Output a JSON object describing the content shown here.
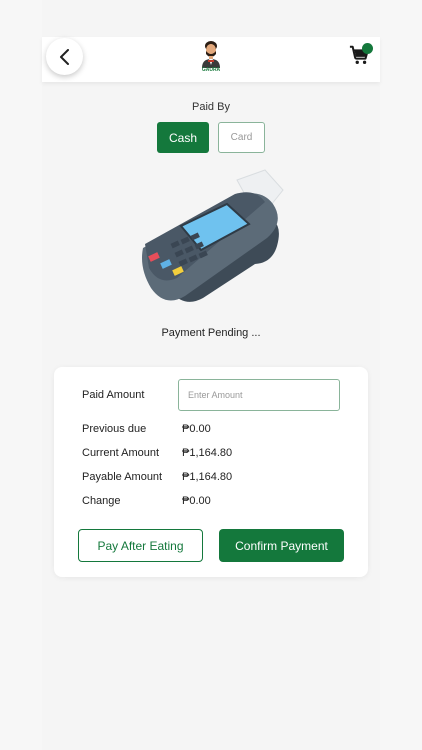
{
  "header": {
    "back_icon": "chevron-left-icon",
    "logo_icon": "mascot-logo",
    "logo_text": "GAURA",
    "cart_icon": "cart-icon",
    "accent_color": "#14783c"
  },
  "payment": {
    "paid_by_label": "Paid By",
    "methods": [
      "Cash",
      "Card"
    ],
    "selected_method": "Cash",
    "status": "Payment Pending ..."
  },
  "summary": {
    "paid_amount_label": "Paid Amount",
    "paid_amount_placeholder": "Enter Amount",
    "rows": [
      {
        "label": "Previous due",
        "value": "₱0.00"
      },
      {
        "label": "Current Amount",
        "value": "₱1,164.80"
      },
      {
        "label": "Payable Amount",
        "value": "₱1,164.80"
      },
      {
        "label": "Change",
        "value": "₱0.00"
      }
    ]
  },
  "actions": {
    "pay_after_label": "Pay After Eating",
    "confirm_label": "Confirm Payment"
  }
}
